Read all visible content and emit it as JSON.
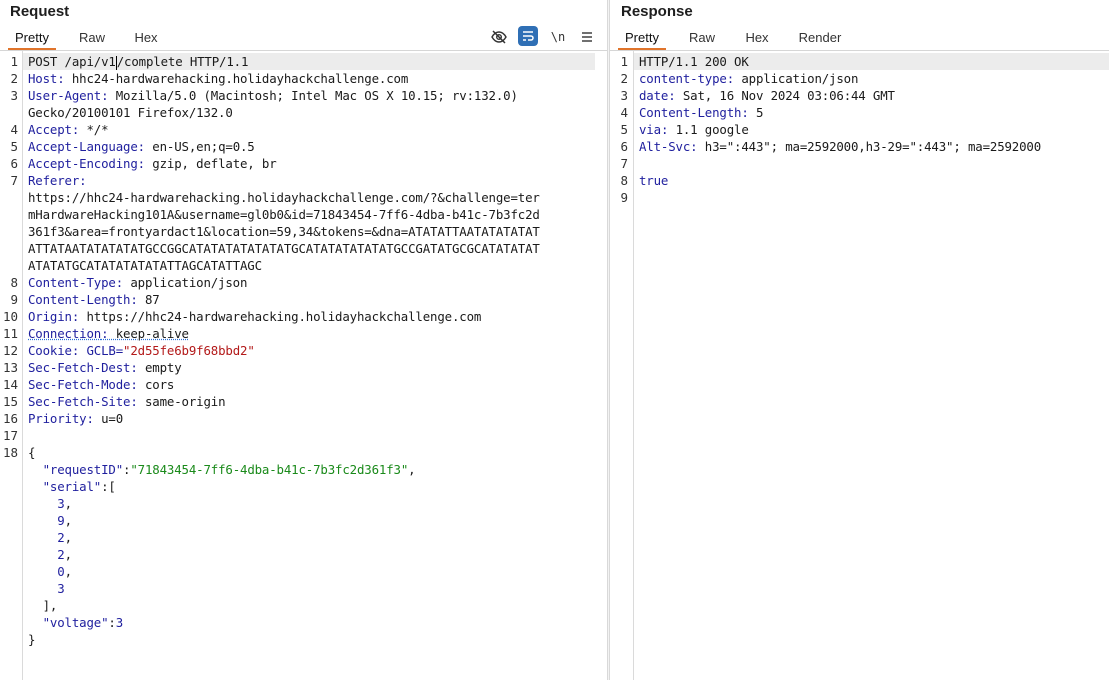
{
  "request": {
    "title": "Request",
    "tabs": [
      "Pretty",
      "Raw",
      "Hex"
    ],
    "active_tab": "Pretty",
    "toolbar": {
      "hide_icon": "eye-slash-icon",
      "wrap_icon": "wrap-lines-icon",
      "newline_label": "\\n",
      "menu_icon": "menu-icon"
    },
    "line_numbers": [
      "1",
      "2",
      "3",
      "4",
      "5",
      "6",
      "7",
      "8",
      "9",
      "10",
      "11",
      "12",
      "13",
      "14",
      "15",
      "16",
      "17",
      "18"
    ],
    "request_line_a": "POST /api/v1",
    "request_line_b": "/complete HTTP/1.1",
    "headers": [
      {
        "name": "Host",
        "value": "hhc24-hardwarehacking.holidayhackchallenge.com"
      },
      {
        "name": "User-Agent",
        "value": "Mozilla/5.0 (Macintosh; Intel Mac OS X 10.15; rv:132.0)"
      },
      {
        "name": "Accept",
        "value": "*/*"
      },
      {
        "name": "Accept-Language",
        "value": "en-US,en;q=0.5"
      },
      {
        "name": "Accept-Encoding",
        "value": "gzip, deflate, br"
      },
      {
        "name": "Referer",
        "value": ""
      },
      {
        "name": "Content-Type",
        "value": "application/json"
      },
      {
        "name": "Content-Length",
        "value": "87"
      },
      {
        "name": "Origin",
        "value": "https://hhc24-hardwarehacking.holidayhackchallenge.com"
      },
      {
        "name": "Connection",
        "value": "keep-alive"
      },
      {
        "name": "Cookie",
        "value": "GCLB="
      },
      {
        "name": "Sec-Fetch-Dest",
        "value": "empty"
      },
      {
        "name": "Sec-Fetch-Mode",
        "value": "cors"
      },
      {
        "name": "Sec-Fetch-Site",
        "value": "same-origin"
      },
      {
        "name": "Priority",
        "value": "u=0"
      }
    ],
    "user_agent_cont": "Gecko/20100101 Firefox/132.0",
    "referer_lines": [
      "https://hhc24-hardwarehacking.holidayhackchallenge.com/?&challenge=ter",
      "mHardwareHacking101A&username=gl0b0&id=71843454-7ff6-4dba-b41c-7b3fc2d",
      "361f3&area=frontyardact1&location=59,34&tokens=&dna=ATATATTAATATATATAT",
      "ATTATAATATATATATGCCGGCATATATATATATATGCATATATATATATGCCGATATGCGCATATATAT",
      "ATATATGCATATATATATATTAGCATATTAGC"
    ],
    "cookie_value": "\"2d55fe6b9f68bbd2\"",
    "body": {
      "open_brace": "{",
      "request_id_key": "\"requestID\"",
      "request_id_value": "\"71843454-7ff6-4dba-b41c-7b3fc2d361f3\"",
      "serial_key": "\"serial\"",
      "serial_values": [
        "3",
        "9",
        "2",
        "2",
        "0",
        "3"
      ],
      "close_bracket": "],",
      "voltage_key": "\"voltage\"",
      "voltage_value": "3",
      "close_brace": "}"
    }
  },
  "response": {
    "title": "Response",
    "tabs": [
      "Pretty",
      "Raw",
      "Hex",
      "Render"
    ],
    "active_tab": "Pretty",
    "line_numbers": [
      "1",
      "2",
      "3",
      "4",
      "5",
      "6",
      "7",
      "8",
      "9"
    ],
    "status_line": "HTTP/1.1 200 OK",
    "headers": [
      {
        "name": "content-type",
        "value": "application/json"
      },
      {
        "name": "date",
        "value": "Sat, 16 Nov 2024 03:06:44 GMT"
      },
      {
        "name": "Content-Length",
        "value": "5"
      },
      {
        "name": "via",
        "value": "1.1 google"
      },
      {
        "name": "Alt-Svc",
        "value": "h3=\":443\"; ma=2592000,h3-29=\":443\"; ma=2592000"
      }
    ],
    "body": "true"
  },
  "colors": {
    "accent": "#e0742b",
    "header_key": "#1f1f9e",
    "json_string": "#1a8a1a",
    "cookie_value": "#b31a1a",
    "wrap_icon_bg": "#2f6fb5"
  }
}
